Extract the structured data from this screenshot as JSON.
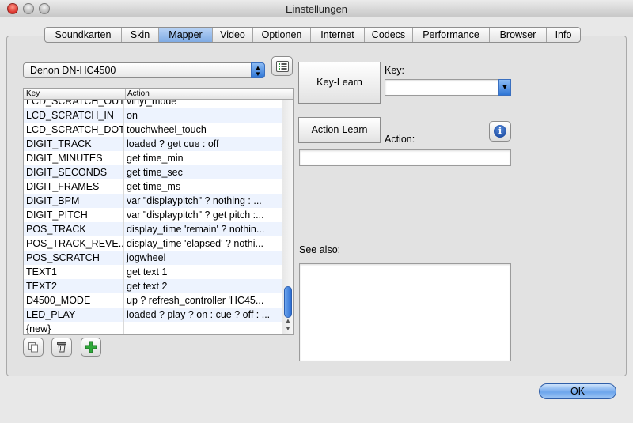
{
  "window": {
    "title": "Einstellungen"
  },
  "tabs": [
    {
      "label": "Soundkarten"
    },
    {
      "label": "Skin"
    },
    {
      "label": "Mapper"
    },
    {
      "label": "Video"
    },
    {
      "label": "Optionen"
    },
    {
      "label": "Internet"
    },
    {
      "label": "Codecs"
    },
    {
      "label": "Performance"
    },
    {
      "label": "Browser"
    },
    {
      "label": "Info"
    }
  ],
  "active_tab": "Mapper",
  "mapper": {
    "device_select": "Denon DN-HC4500",
    "table": {
      "columns": {
        "key": "Key",
        "action": "Action"
      },
      "rows": [
        {
          "key": "LCD_SCRATCH_OUT",
          "action": "vinyl_mode"
        },
        {
          "key": "LCD_SCRATCH_IN",
          "action": "on"
        },
        {
          "key": "LCD_SCRATCH_DOT",
          "action": "touchwheel_touch"
        },
        {
          "key": "DIGIT_TRACK",
          "action": "loaded ? get cue : off"
        },
        {
          "key": "DIGIT_MINUTES",
          "action": "get time_min"
        },
        {
          "key": "DIGIT_SECONDS",
          "action": "get time_sec"
        },
        {
          "key": "DIGIT_FRAMES",
          "action": "get time_ms"
        },
        {
          "key": "DIGIT_BPM",
          "action": "var \"displaypitch\" ? nothing : ..."
        },
        {
          "key": "DIGIT_PITCH",
          "action": "var \"displaypitch\" ? get pitch :..."
        },
        {
          "key": "POS_TRACK",
          "action": "display_time 'remain' ? nothin..."
        },
        {
          "key": "POS_TRACK_REVE...",
          "action": "display_time 'elapsed' ? nothi..."
        },
        {
          "key": "POS_SCRATCH",
          "action": "jogwheel"
        },
        {
          "key": "TEXT1",
          "action": "get text 1"
        },
        {
          "key": "TEXT2",
          "action": "get text 2"
        },
        {
          "key": "D4500_MODE",
          "action": "up ? refresh_controller 'HC45..."
        },
        {
          "key": "LED_PLAY",
          "action": "loaded ? play ? on : cue ? off : ..."
        },
        {
          "key": "{new}",
          "action": ""
        }
      ]
    },
    "key_learn_label": "Key-Learn",
    "key_label": "Key:",
    "key_value": "",
    "action_learn_label": "Action-Learn",
    "action_label": "Action:",
    "action_value": "",
    "see_also_label": "See also:",
    "see_also_value": "",
    "info_icon_glyph": "i",
    "add_icon_glyph": "+"
  },
  "ok_label": "OK",
  "colors": {
    "accent": "#5b97e6",
    "row_alt": "#edf3fe",
    "add_green": "#2fa83a"
  }
}
